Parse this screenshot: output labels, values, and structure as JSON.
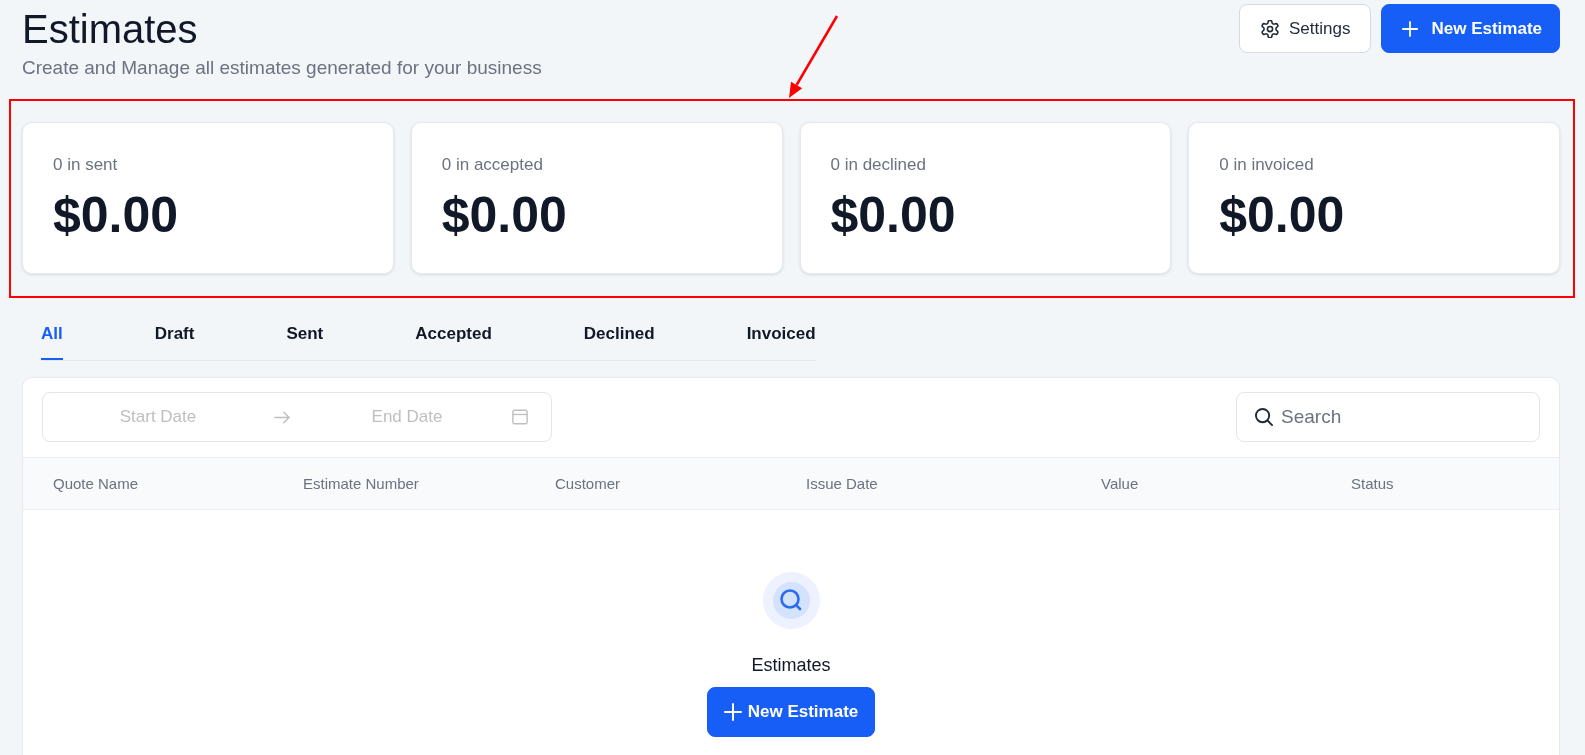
{
  "header": {
    "title": "Estimates",
    "subtitle": "Create and Manage all estimates generated for your business",
    "actions": [
      {
        "kind": "secondary",
        "label": "Settings"
      },
      {
        "kind": "primary",
        "label": "New Estimate"
      }
    ]
  },
  "stats": {
    "highlighted": true,
    "cards": [
      {
        "label": "0 in sent",
        "value": "$0.00"
      },
      {
        "label": "0 in accepted",
        "value": "$0.00"
      },
      {
        "label": "0 in declined",
        "value": "$0.00"
      },
      {
        "label": "0 in invoiced",
        "value": "$0.00"
      }
    ]
  },
  "tabs": [
    {
      "label": "All",
      "selected": true
    },
    {
      "label": "Draft",
      "selected": false
    },
    {
      "label": "Sent",
      "selected": false
    },
    {
      "label": "Accepted",
      "selected": false
    },
    {
      "label": "Declined",
      "selected": false
    },
    {
      "label": "Invoiced",
      "selected": false
    }
  ],
  "filters": {
    "date_range": {
      "start_placeholder": "Start Date",
      "end_placeholder": "End Date"
    },
    "search": {
      "placeholder": "Search"
    }
  },
  "table": {
    "columns": [
      "Quote Name",
      "Estimate Number",
      "Customer",
      "Issue Date",
      "Value",
      "Status"
    ]
  },
  "empty_state": {
    "title": "Estimates",
    "button": {
      "label": "New Estimate"
    }
  }
}
